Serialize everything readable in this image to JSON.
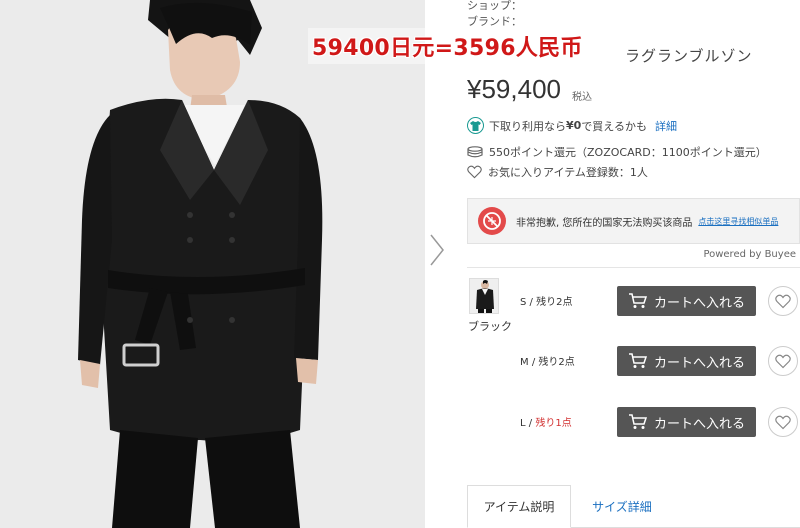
{
  "overlay": {
    "price_conversion": "59400日元=3596人民币"
  },
  "product": {
    "shop_label": "ショップ：",
    "brand_label": "ブランド：",
    "name_partial": "ラグランブルゾン",
    "price": "¥59,400",
    "tax_label": "税込"
  },
  "info": {
    "trade_in": "下取り利用なら",
    "trade_in_value": "¥0",
    "trade_in_suffix": "で買えるかも",
    "detail_link": "詳細",
    "points": "550ポイント還元（ZOZOCARD：1100ポイント還元）",
    "favorites": "お気に入りアイテム登録数：1人"
  },
  "notice": {
    "text": "非常抱歉, 您所在的国家无法购买该商品",
    "link": "点击这里寻找相似单品",
    "powered_by": "Powered by Buyee"
  },
  "variant": {
    "color_name": "ブラック",
    "sizes": [
      {
        "size": "S",
        "stock": "残り2点",
        "low": false,
        "cart_label": "カートへ入れる"
      },
      {
        "size": "M",
        "stock": "残り2点",
        "low": false,
        "cart_label": "カートへ入れる"
      },
      {
        "size": "L",
        "stock": "残り1点",
        "low": true,
        "cart_label": "カートへ入れる"
      }
    ]
  },
  "tabs": [
    {
      "label": "アイテム説明",
      "active": true
    },
    {
      "label": "サイズ詳細",
      "active": false
    }
  ],
  "icons": {
    "trade_in": "shirt-icon",
    "points": "coins-icon",
    "favorites": "heart-icon",
    "notice": "no-entry-icon",
    "cart": "cart-icon",
    "next": "chevron-right-icon"
  },
  "colors": {
    "accent_teal": "#1a9a92",
    "link_blue": "#1a6fc0",
    "overlay_red": "#d01818",
    "cart_button": "#555555",
    "notice_red": "#e34a4a"
  }
}
